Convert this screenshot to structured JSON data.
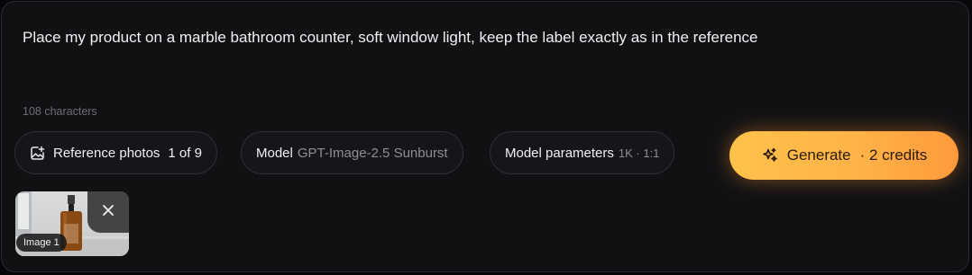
{
  "prompt": {
    "text": "Place my product on a marble bathroom counter, soft window light, keep the label exactly as in the reference",
    "char_count": "108 characters"
  },
  "toolbar": {
    "reference_photos": {
      "label": "Reference photos",
      "count": "1 of 9",
      "icon": "image-add-icon"
    },
    "model": {
      "label": "Model",
      "value": "GPT-Image-2.5 Sunburst"
    },
    "model_parameters": {
      "label": "Model parameters",
      "value": "1K · 1:1"
    },
    "generate": {
      "label": "Generate",
      "credits": "· 2 credits",
      "icon": "sparkles-icon"
    }
  },
  "attachments": [
    {
      "label": "Image 1",
      "close_icon": "close-icon"
    }
  ],
  "colors": {
    "panel_bg": "#111114",
    "generate_gradient_start": "#ffc24a",
    "generate_gradient_end": "#ff9a3c"
  }
}
